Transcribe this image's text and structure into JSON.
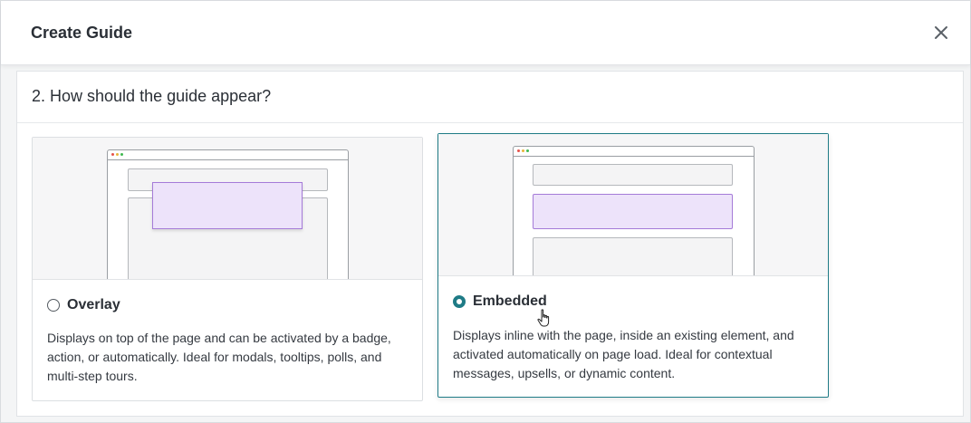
{
  "header": {
    "title": "Create Guide"
  },
  "section": {
    "heading": "2. How should the guide appear?"
  },
  "options": [
    {
      "id": "overlay",
      "title": "Overlay",
      "selected": false,
      "description": "Displays on top of the page and can be activated by a badge, action, or automatically. Ideal for modals, tooltips, polls, and multi-step tours."
    },
    {
      "id": "embedded",
      "title": "Embedded",
      "selected": true,
      "description": "Displays inline with the page, inside an existing element, and activated automatically on page load. Ideal for contextual messages, upsells, or dynamic content."
    }
  ],
  "colors": {
    "accent": "#1f7b86",
    "highlight_fill": "#ede3fa",
    "highlight_border": "#a57bd8",
    "dot_red": "#e5534b",
    "dot_yellow": "#e8b53a",
    "dot_green": "#3fb950"
  },
  "icons": {
    "close": "close-icon",
    "cursor": "hand-pointer-cursor-icon"
  }
}
